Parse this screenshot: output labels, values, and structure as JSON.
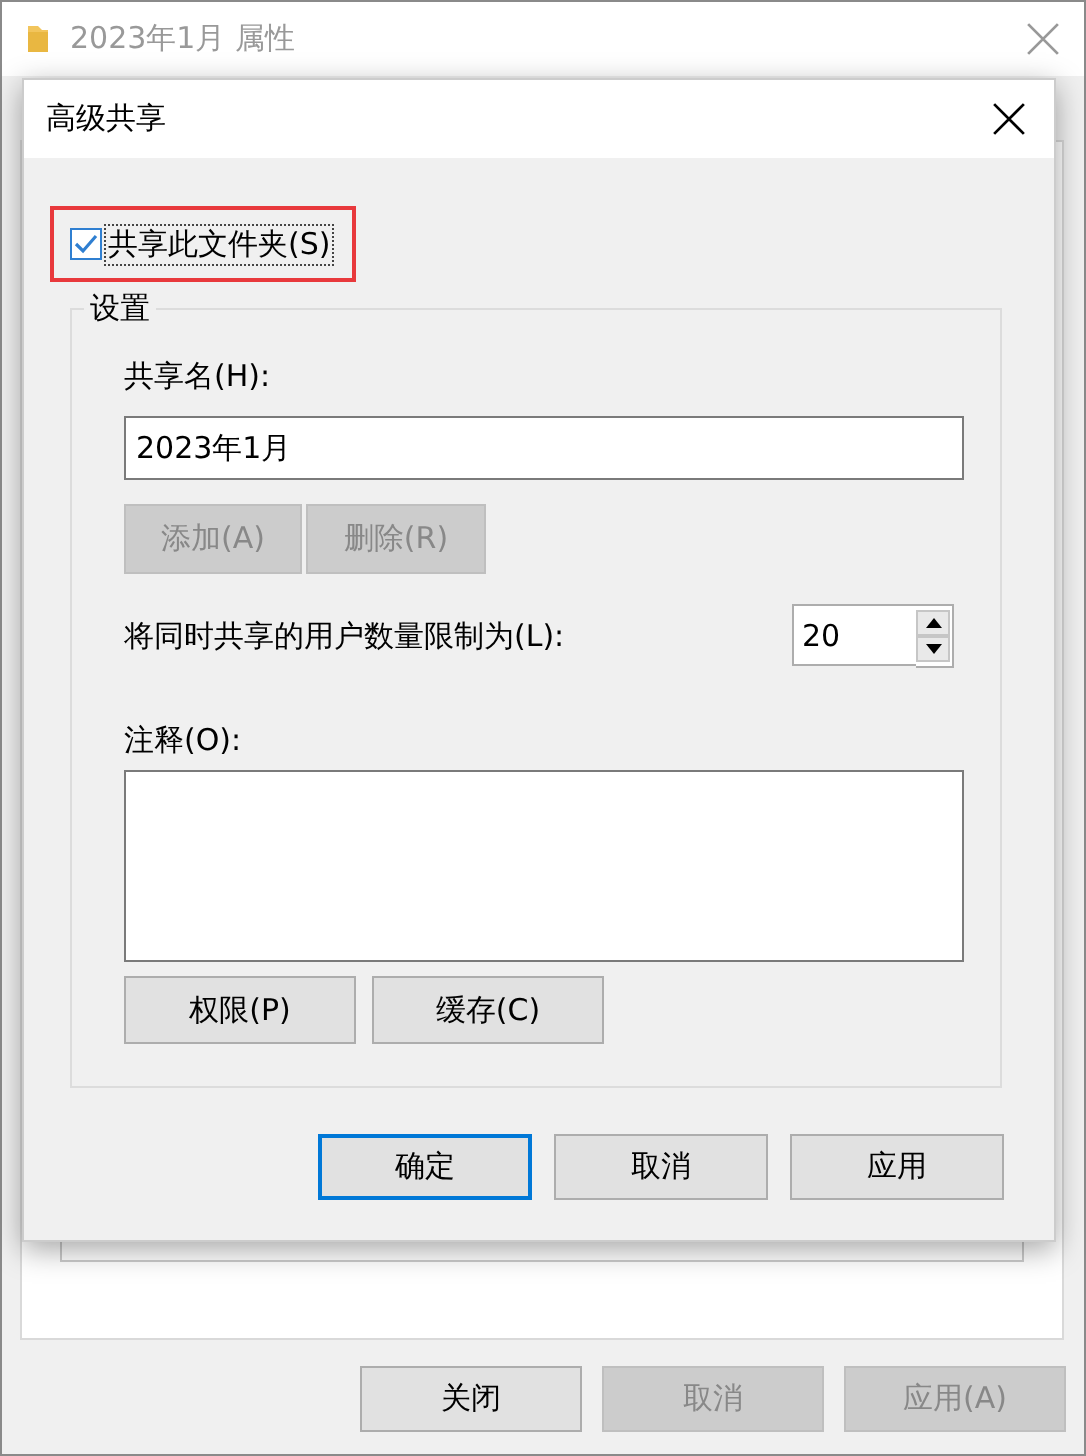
{
  "background_window": {
    "title": "2023年1月 属性",
    "buttons": [
      {
        "label": "关闭",
        "disabled": false
      },
      {
        "label": "取消",
        "disabled": true
      },
      {
        "label": "应用(A)",
        "disabled": true
      }
    ]
  },
  "dialog": {
    "title": "高级共享",
    "share_checkbox": {
      "label": "共享此文件夹(S)",
      "checked": true,
      "highlighted": true
    },
    "settings": {
      "title": "设置",
      "share_name_label": "共享名(H):",
      "share_name_value": "2023年1月",
      "name_buttons": [
        {
          "label": "添加(A)",
          "disabled": true
        },
        {
          "label": "删除(R)",
          "disabled": true
        }
      ],
      "limit_label": "将同时共享的用户数量限制为(L):",
      "limit_value": "20",
      "comment_label": "注释(O):",
      "buttons": [
        {
          "label": "权限(P)",
          "disabled": false
        },
        {
          "label": "缓存(C)",
          "disabled": false
        }
      ]
    },
    "buttons": [
      {
        "label": "确定",
        "default": true
      },
      {
        "label": "取消",
        "default": false
      },
      {
        "label": "应用",
        "default": false
      }
    ]
  }
}
